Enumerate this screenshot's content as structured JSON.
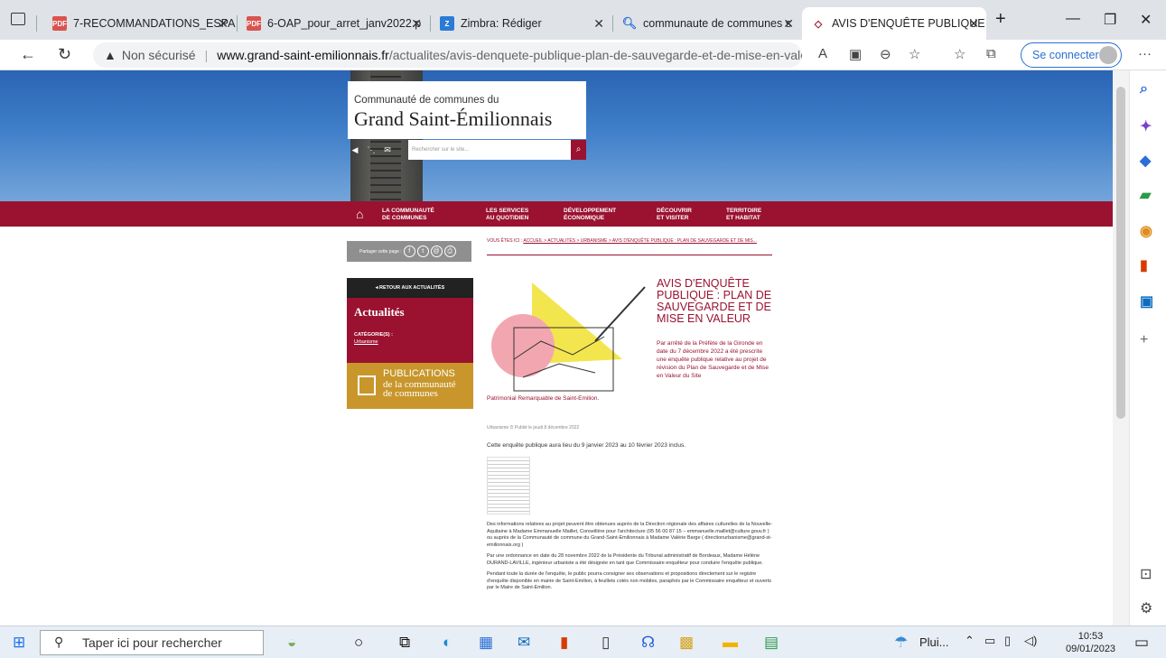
{
  "tabs": [
    {
      "title": "7-RECOMMANDATIONS_ESPA",
      "favicon": "pdf-icon"
    },
    {
      "title": "6-OAP_pour_arret_janv2022.p",
      "favicon": "pdf-icon"
    },
    {
      "title": "Zimbra: Rédiger",
      "favicon": "zimbra-icon"
    },
    {
      "title": "communaute de communes s",
      "favicon": "search-icon"
    },
    {
      "title": "AVIS D'ENQUÊTE PUBLIQUE",
      "favicon": "site-icon"
    }
  ],
  "address": {
    "security": "Non sécurisé",
    "domain": "www.grand-saint-emilionnais.fr",
    "path": "/actualites/avis-denquete-publique-plan-de-sauvegarde-et-de-mise-en-valeur/"
  },
  "signin_label": "Se connecter",
  "site": {
    "logo_line1": "Communauté de communes du",
    "logo_line2": "Grand Saint-Émilionnais",
    "search_placeholder": "Rechercher sur le site..."
  },
  "menu": [
    "LA COMMUNAUTÉ\nDE COMMUNES",
    "LES SERVICES\nAU QUOTIDIEN",
    "DÉVELOPPEMENT\nÉCONOMIQUE",
    "DÉCOUVRIR\nET VISITER",
    "TERRITOIRE\nET HABITAT"
  ],
  "sidebar": {
    "share_label": "Partager cette page :",
    "back_label": "◂  RETOUR AUX ACTUALITÉS",
    "section_title": "Actualités",
    "categories_label": "CATÉGORIE(S) :",
    "category": "Urbanisme",
    "pub_line1": "PUBLICATIONS",
    "pub_line2": "de la communauté\nde communes"
  },
  "article": {
    "breadcrumb_prefix": "VOUS ÊTES ICI :",
    "breadcrumb": "ACCUEIL > ACTUALITÉS > URBANISME > AVIS D'ENQUÊTE PUBLIQUE : PLAN DE SAUVEGARDE ET DE MIS...",
    "title": "AVIS D'ENQUÊTE PUBLIQUE : PLAN DE SAUVEGARDE ET DE MISE EN VALEUR",
    "lead": "Par arrêté de la Préfète de la Gironde en date du 7 décembre 2022 a été prescrite une enquête publique relative au projet de révision du Plan de Sauvegarde et de Mise en Valeur du Site",
    "lead_end": "Patrimonial Remarquable de Saint-Emilion.",
    "meta": "Urbanisme   ⏱ Publié le jeudi 8 décembre 2022",
    "intro": "Cette enquête publique aura lieu du 9 janvier 2023 au 10 février 2023 inclus.",
    "para1": "Des informations relatives au projet peuvent être obtenues auprès de la Direction régionale des affaires culturelles de la Nouvelle-Aquitaine à Madame Emmanuelle Maillet, Conseillère pour l'architecture (05 56 00 87 15 – emmanuelle.maillet@culture.gouv.fr ) ou auprès de la Communauté de commune du Grand-Saint-Emilionnais à Madame Valérie Barge ( directionurbanisme@grand-st-emilionnais.org )",
    "para2": "Par une ordonnance en date du 28 novembre 2022 de la Présidente du Tribunal administratif de Bordeaux, Madame Hélène DURAND-LAVILLE, ingénieur urbaniste a été désignée en tant que Commissaire enquêteur pour conduire l'enquête publique.",
    "para3": "Pendant toute la durée de l'enquête, le public pourra consigner ses observations et propositions directement sur le registre d'enquête disponible en mairie de Saint-Emilion, à feuillets cotés non mobiles, paraphés par le Commissaire enquêteur et ouverts par le Maire de Saint-Emilion."
  },
  "taskbar": {
    "search_placeholder": "Taper ici pour rechercher",
    "weather": "Plui...",
    "time": "10:53",
    "date": "09/01/2023"
  },
  "colors": {
    "accent": "#9a1230",
    "gold": "#c8962b"
  }
}
